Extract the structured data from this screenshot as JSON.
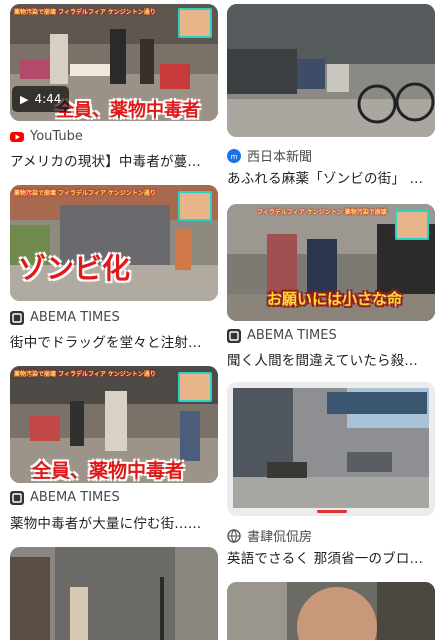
{
  "results": [
    {
      "source": "YouTube",
      "source_icon": "youtube-icon",
      "title": "アメリカの現状】中毒者が蔓...",
      "duration": "4:44",
      "overlay": "全員、薬物中毒者",
      "banner": "薬物汚染で崩壊 フィラデルフィア ケンジントン通り"
    },
    {
      "source": "西日本新聞",
      "source_icon": "news-icon",
      "title": "あふれる麻薬「ゾンビの街」 ..."
    },
    {
      "source": "ABEMA TIMES",
      "source_icon": "abema-icon",
      "title": "街中でドラッグを堂々と注射...",
      "overlay": "ゾンビ化",
      "banner": "薬物汚染で崩壊 フィラデルフィア ケンジントン通り"
    },
    {
      "source": "ABEMA TIMES",
      "source_icon": "abema-icon",
      "title": "聞く人間を間違えていたら殺...",
      "overlay": "お願いには小さな命",
      "banner": "フィラデルフィア ケンジントン 薬物汚染で崩壊"
    },
    {
      "source": "ABEMA TIMES",
      "source_icon": "abema-icon",
      "title": "薬物中毒者が大量に佇む街......",
      "overlay": "全員、薬物中毒者",
      "banner": "薬物汚染で崩壊 フィラデルフィア ケンジントン通り"
    },
    {
      "source": "書肆侃侃房",
      "source_icon": "globe-icon",
      "title": "英語でさるく 那須省一のブロ..."
    },
    {
      "source": "",
      "title": ""
    },
    {
      "source": "",
      "title": ""
    }
  ],
  "colors": {
    "youtube_red": "#ff0000",
    "news_blue": "#1a73e8",
    "overlay_red": "#e01818",
    "overlay_gold": "#ffdc2e"
  }
}
